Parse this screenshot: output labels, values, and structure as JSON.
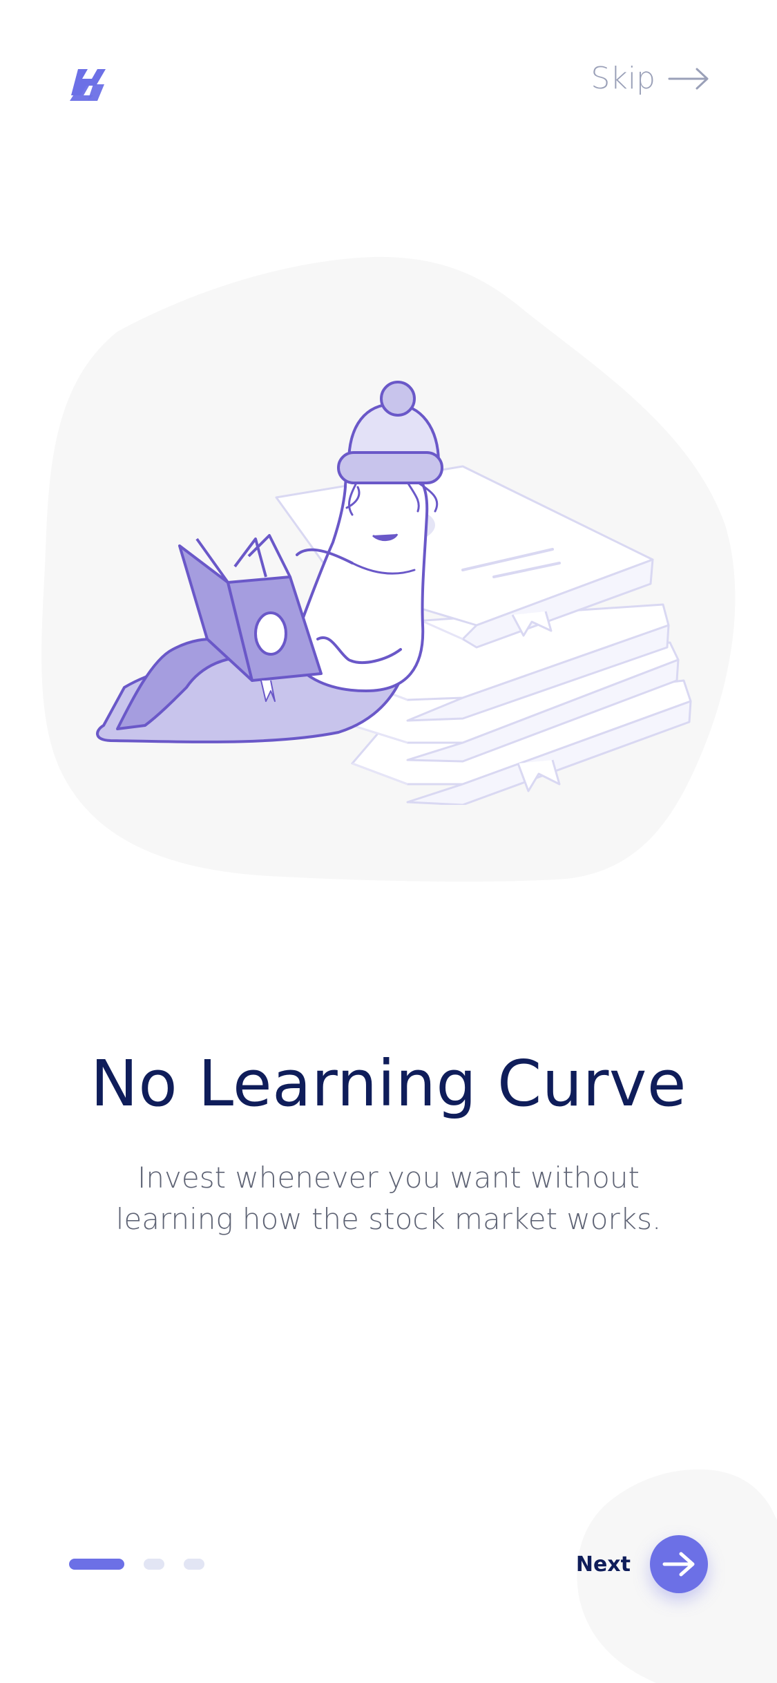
{
  "header": {
    "logo_icon": "brand-logo-icon",
    "skip_label": "Skip",
    "skip_icon": "arrow-right-icon"
  },
  "hero": {
    "illustration": "character-reading-book-on-books-illustration"
  },
  "content": {
    "title": "No Learning Curve",
    "subtitle": "Invest whenever you want without learning how the stock market works."
  },
  "footer": {
    "pager": {
      "total": 3,
      "active_index": 0
    },
    "next_label": "Next",
    "next_icon": "arrow-right-icon"
  },
  "colors": {
    "accent": "#6c70e6",
    "title": "#0f1d5a",
    "body": "#5e6374",
    "muted": "#9aa0b8",
    "blob": "#f7f7f7",
    "dot_inactive": "#e2e5f4"
  }
}
